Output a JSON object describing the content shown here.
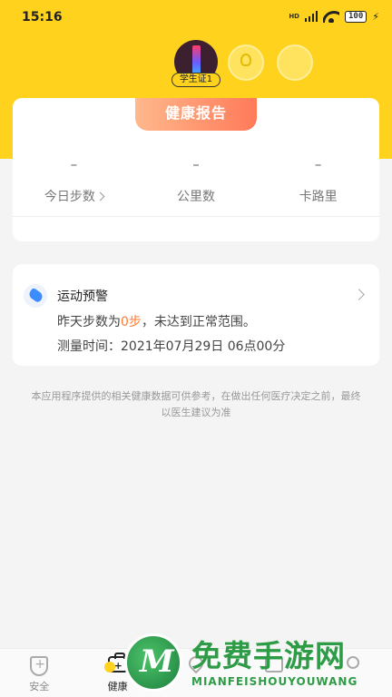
{
  "status_bar": {
    "time": "15:16",
    "network": "HD",
    "battery": "100"
  },
  "profile": {
    "badge": "学生证1"
  },
  "health_card": {
    "title": "健康报告",
    "stats": [
      {
        "value": "–",
        "label": "今日步数"
      },
      {
        "value": "–",
        "label": "公里数"
      },
      {
        "value": "–",
        "label": "卡路里"
      }
    ]
  },
  "alert": {
    "title": "运动预警",
    "line1_prefix": "昨天步数为",
    "line1_value": "0步",
    "line1_suffix": "，未达到正常范围。",
    "line2": "测量时间：2021年07月29日 06点00分"
  },
  "disclaimer": "本应用程序提供的相关健康数据可供参考，在做出任何医疗决定之前，最终以医生建议为准",
  "tabs": [
    {
      "label": "安全",
      "icon": "shield-icon",
      "active": false
    },
    {
      "label": "健康",
      "icon": "medical-kit-icon",
      "active": true
    },
    {
      "label": "",
      "icon": "location-icon",
      "active": false
    },
    {
      "label": "",
      "icon": "book-icon",
      "active": false
    },
    {
      "label": "",
      "icon": "profile-icon",
      "active": false
    }
  ],
  "watermark": {
    "title": "免费手游网",
    "subtitle": "MIANFEISHOUYOUWANG"
  },
  "colors": {
    "brand_yellow": "#ffd21e",
    "report_tab_gradient": [
      "#ffb88c",
      "#ff7a59"
    ],
    "highlight_orange": "#ff7a2e",
    "watermark_green": "#2e9b46"
  }
}
